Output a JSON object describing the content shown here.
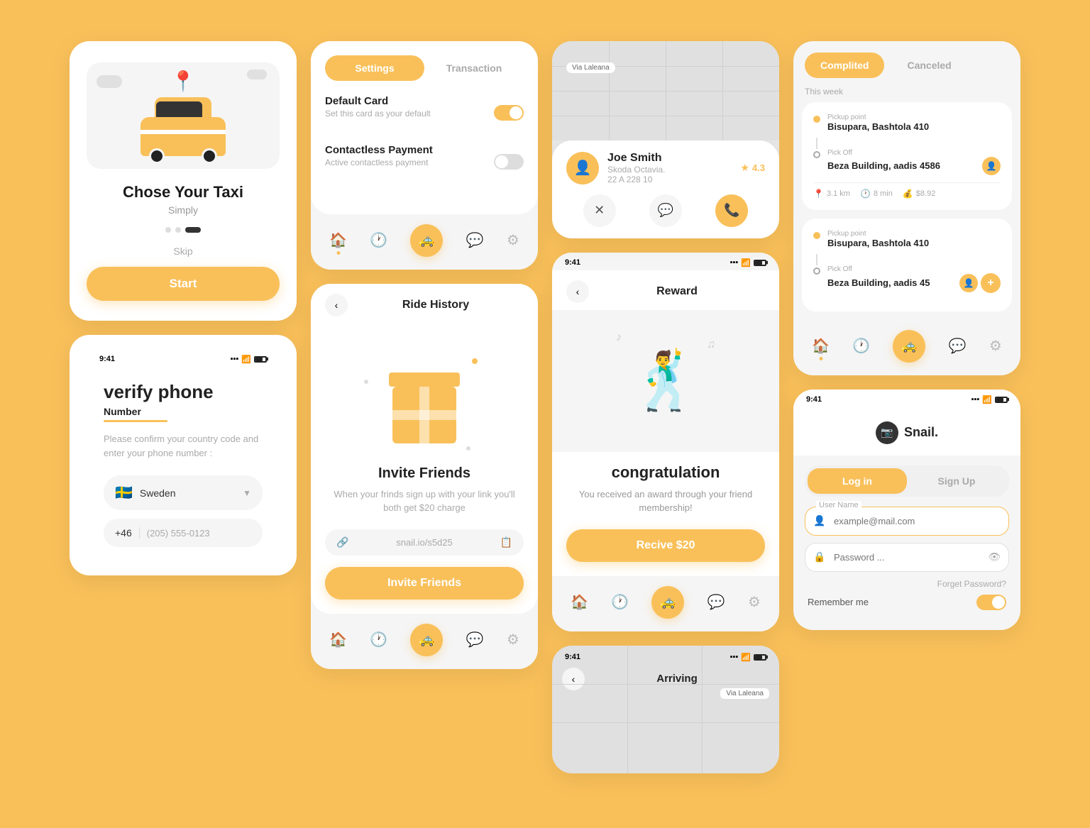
{
  "colors": {
    "primary": "#F9C05A",
    "bg": "#F9C05A",
    "white": "#ffffff",
    "text_dark": "#1a1a1a",
    "text_gray": "#999999",
    "text_light": "#cccccc"
  },
  "card1": {
    "title": "Chose Your Taxi",
    "subtitle": "Simply",
    "skip_label": "Skip",
    "start_label": "Start"
  },
  "card2": {
    "tab_settings": "Settings",
    "tab_transaction": "Transaction",
    "default_card_label": "Default Card",
    "default_card_desc": "Set this card as your default",
    "contactless_label": "Contactless Payment",
    "contactless_desc": "Active contactless payment"
  },
  "card3_driver": {
    "name": "Joe Smith",
    "plate": "Skoda Octavia.",
    "plate2": "22 A 228 10",
    "rating": "4.3"
  },
  "card4_invite": {
    "header": "Ride History",
    "title": "Invite Friends",
    "desc": "When your frinds sign up with your link you'll both get $20 charge",
    "link": "snail.io/s5d25",
    "btn_label": "Invite Friends"
  },
  "reward": {
    "header": "Reward",
    "title": "congratulation",
    "desc": "You received an award through your friend membership!",
    "btn_label": "Recive $20"
  },
  "verify": {
    "title": "verify phone",
    "underline_label": "Number",
    "desc": "Please confirm your country code and enter your phone number :",
    "country": "Sweden",
    "country_code": "+46",
    "phone_placeholder": "(205) 555-0123"
  },
  "history": {
    "tab_completed": "Complited",
    "tab_canceled": "Canceled",
    "week_label": "This week",
    "trip1": {
      "pickup_label": "Pickup point",
      "pickup": "Bisupara, Bashtola 410",
      "dropoff_label": "Pick Off",
      "dropoff": "Beza Building, aadis 4586",
      "distance": "3.1 km",
      "time": "8 min",
      "price": "$8.92"
    },
    "trip2": {
      "pickup_label": "Pickup point",
      "pickup": "Bisupara, Bashtola 410",
      "dropoff_label": "Pick Off",
      "dropoff": "Beza Building, aadis 45"
    }
  },
  "arriving": {
    "title": "Arriving"
  },
  "login": {
    "logo": "Snail.",
    "tab_login": "Log in",
    "tab_signup": "Sign Up",
    "username_label": "User Name",
    "username_placeholder": "example@mail.com",
    "password_placeholder": "Password ...",
    "forget_label": "Forget Password?",
    "remember_label": "Remember me"
  },
  "nav": {
    "home": "🏠",
    "clock": "🕐",
    "taxi": "🚕",
    "chat": "💬",
    "settings": "⚙"
  },
  "status_bar": {
    "time": "9:41"
  }
}
